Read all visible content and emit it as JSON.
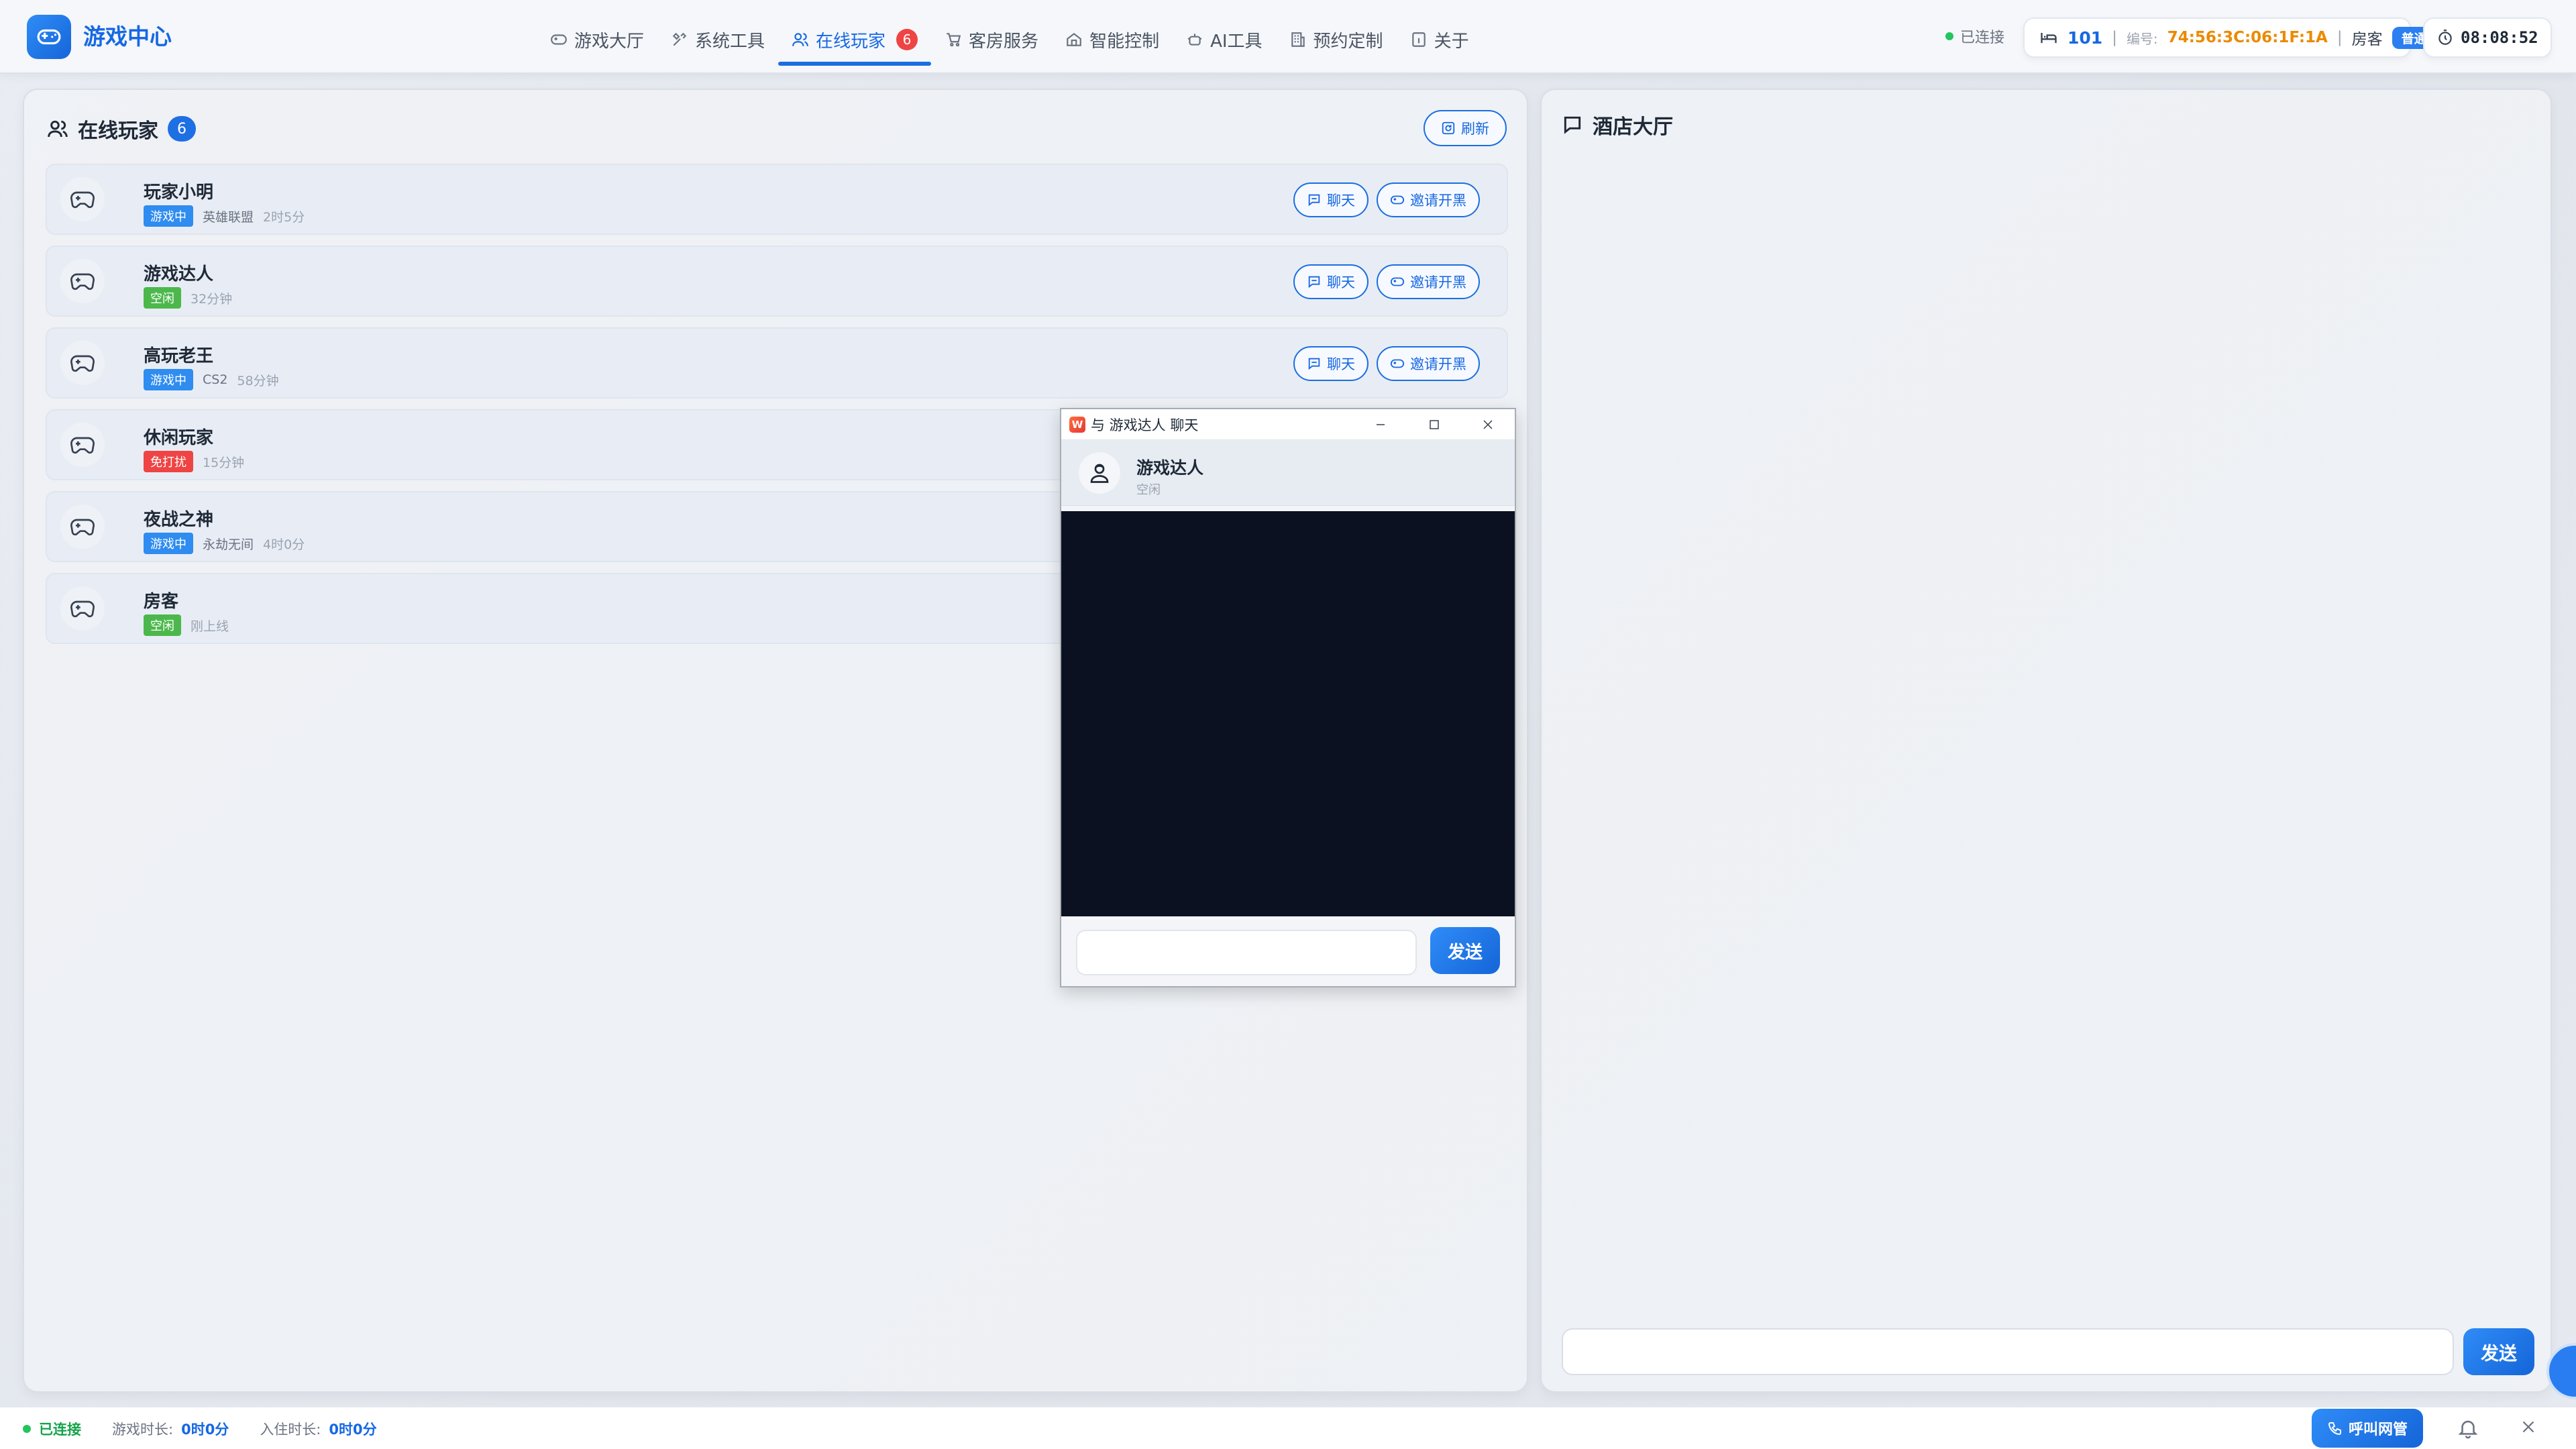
{
  "app": {
    "title": "游戏中心"
  },
  "nav": {
    "items": [
      {
        "label": "游戏大厅",
        "icon": "gamepad-icon"
      },
      {
        "label": "系统工具",
        "icon": "tools-icon"
      },
      {
        "label": "在线玩家",
        "icon": "users-icon",
        "badge": "6",
        "active": true
      },
      {
        "label": "客房服务",
        "icon": "cart-icon"
      },
      {
        "label": "智能控制",
        "icon": "home-icon"
      },
      {
        "label": "AI工具",
        "icon": "robot-icon"
      },
      {
        "label": "预约定制",
        "icon": "building-icon"
      },
      {
        "label": "关于",
        "icon": "info-icon"
      }
    ]
  },
  "status": {
    "connection": "已连接",
    "room_number": "101",
    "id_label": "编号:",
    "mac": "74:56:3C:06:1F:1A",
    "guest_label": "房客",
    "level": "普通",
    "timer": "08:08:52"
  },
  "players_panel": {
    "title": "在线玩家",
    "count": "6",
    "refresh_label": "刷新",
    "chat_label": "聊天",
    "invite_label": "邀请开黑",
    "players": [
      {
        "name": "玩家小明",
        "status": "游戏中",
        "status_type": "gaming",
        "game": "英雄联盟",
        "time": "2时5分",
        "actions": true
      },
      {
        "name": "游戏达人",
        "status": "空闲",
        "status_type": "idle",
        "game": "",
        "time": "32分钟",
        "actions": true
      },
      {
        "name": "高玩老王",
        "status": "游戏中",
        "status_type": "gaming",
        "game": "CS2",
        "time": "58分钟",
        "actions": true
      },
      {
        "name": "休闲玩家",
        "status": "免打扰",
        "status_type": "dnd",
        "game": "",
        "time": "15分钟",
        "actions": false
      },
      {
        "name": "夜战之神",
        "status": "游戏中",
        "status_type": "gaming",
        "game": "永劫无间",
        "time": "4时0分",
        "actions": false
      },
      {
        "name": "房客",
        "status": "空闲",
        "status_type": "idle",
        "game": "",
        "time": "刚上线",
        "actions": false
      }
    ]
  },
  "lobby": {
    "title": "酒店大厅",
    "input_value": "",
    "send_label": "发送"
  },
  "chat_window": {
    "window_title": "与 游戏达人 聊天",
    "app_icon_letter": "W",
    "peer_name": "游戏达人",
    "peer_status": "空闲",
    "input_value": "",
    "send_label": "发送"
  },
  "statusbar": {
    "connection": "已连接",
    "game_time_label": "游戏时长:",
    "game_time": "0时0分",
    "stay_time_label": "入住时长:",
    "stay_time": "0时0分",
    "call_label": "呼叫网管"
  },
  "colors": {
    "accent": "#1b6fe0",
    "gaming": "#2f8cf0",
    "idle": "#4cb84c",
    "dnd": "#ef4444",
    "warning": "#ea8a00"
  }
}
